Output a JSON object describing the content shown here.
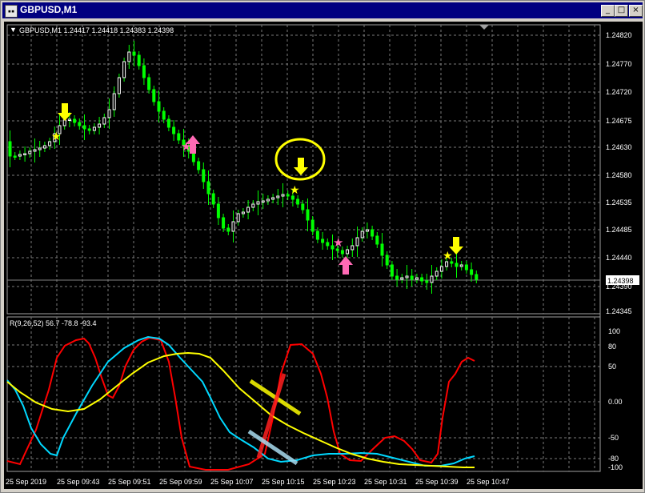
{
  "window": {
    "title": "GBPUSD,M1",
    "app_icon": "chart-window-icon",
    "buttons": [
      {
        "name": "minimize-button",
        "glyph": "_"
      },
      {
        "name": "maximize-button",
        "glyph": "□"
      },
      {
        "name": "close-button",
        "glyph": "×"
      }
    ]
  },
  "main_chart": {
    "header": "GBPUSD,M1  1.24417 1.24418 1.24383 1.24398",
    "price_labels": [
      "1.24820",
      "1.24770",
      "1.24720",
      "1.24675",
      "1.24630",
      "1.24580",
      "1.24535",
      "1.24485",
      "1.24440",
      "1.24390",
      "1.24345"
    ],
    "current_price": "1.24398",
    "colors": {
      "bull": "#ffffff",
      "bear": "#00ff00",
      "grid": "#7a7a7a",
      "signal_sell": "#ffff00",
      "signal_buy": "#ff69b4"
    }
  },
  "indicator": {
    "header": "R(9,26,52) 56.7 -78.8 -93.4",
    "scale_labels": [
      "100",
      "80",
      "50",
      "0.00",
      "-50",
      "-80",
      "-100"
    ],
    "colors": {
      "fast": "#ff0000",
      "medium": "#00d8ff",
      "slow": "#ffff00"
    }
  },
  "time_axis": [
    "25 Sep 2019",
    "25 Sep 09:43",
    "25 Sep 09:51",
    "25 Sep 09:59",
    "25 Sep 10:07",
    "25 Sep 10:15",
    "25 Sep 10:23",
    "25 Sep 10:31",
    "25 Sep 10:39",
    "25 Sep 10:47"
  ]
}
